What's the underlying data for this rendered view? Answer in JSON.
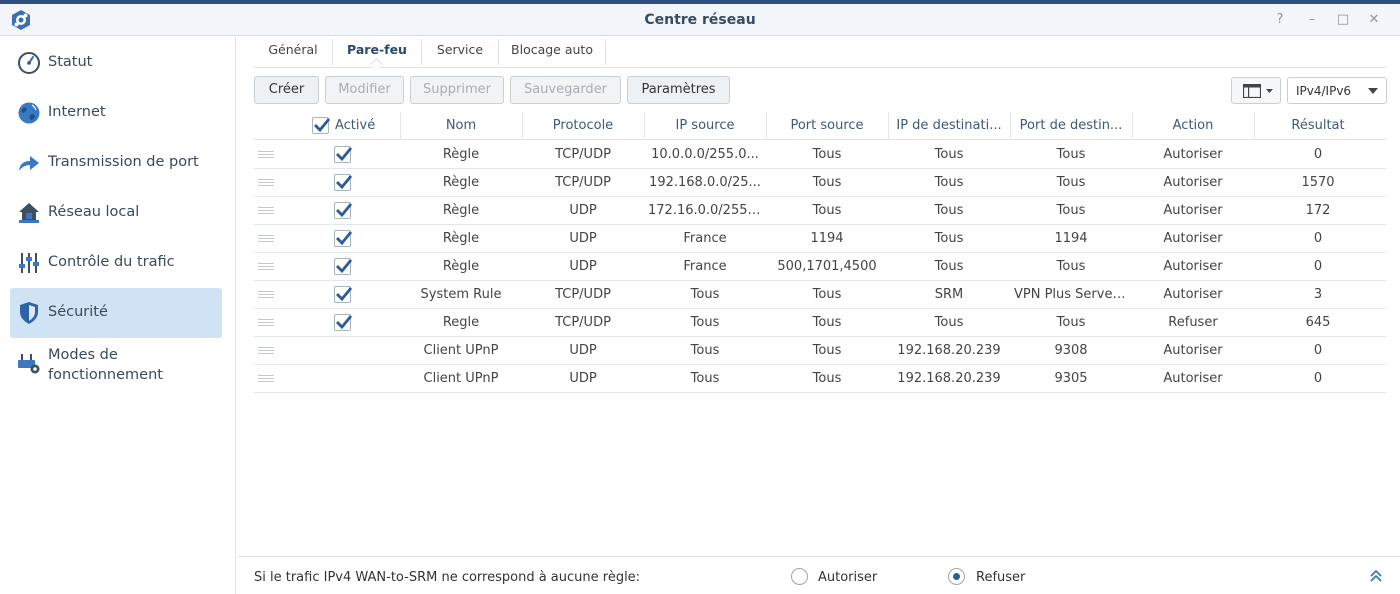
{
  "window": {
    "title": "Centre réseau",
    "controls": [
      "?",
      "–",
      "□",
      "✕"
    ]
  },
  "colors": {
    "accent": "#2a5c99",
    "active_nav": "#cfe3f4",
    "icon_blue": "#3a78c2"
  },
  "sidebar": {
    "items": [
      {
        "label": "Statut",
        "icon": "speedometer-icon"
      },
      {
        "label": "Internet",
        "icon": "globe-icon"
      },
      {
        "label": "Transmission de port",
        "icon": "forward-arrow-icon"
      },
      {
        "label": "Réseau local",
        "icon": "home-network-icon"
      },
      {
        "label": "Contrôle du trafic",
        "icon": "sliders-icon"
      },
      {
        "label": "Sécurité",
        "icon": "shield-icon",
        "active": true
      },
      {
        "label": "Modes de fonctionnement",
        "icon": "router-gear-icon"
      }
    ]
  },
  "tabs": [
    {
      "label": "Général"
    },
    {
      "label": "Pare-feu",
      "active": true
    },
    {
      "label": "Service"
    },
    {
      "label": "Blocage auto"
    }
  ],
  "toolbar": {
    "create": "Créer",
    "modify": "Modifier",
    "delete": "Supprimer",
    "save": "Sauvegarder",
    "settings": "Paramètres",
    "ip_version": "IPv4/IPv6"
  },
  "table": {
    "headers": {
      "enabled": "Activé",
      "name": "Nom",
      "protocol": "Protocole",
      "src_ip": "IP source",
      "src_port": "Port source",
      "dst_ip": "IP de destinati...",
      "dst_port": "Port de destin...",
      "action": "Action",
      "result": "Résultat"
    },
    "rows": [
      {
        "enabled": true,
        "name": "Règle",
        "protocol": "TCP/UDP",
        "src_ip": "10.0.0.0/255.0...",
        "src_port": "Tous",
        "dst_ip": "Tous",
        "dst_port": "Tous",
        "action": "Autoriser",
        "result": "0"
      },
      {
        "enabled": true,
        "name": "Règle",
        "protocol": "TCP/UDP",
        "src_ip": "192.168.0.0/25...",
        "src_port": "Tous",
        "dst_ip": "Tous",
        "dst_port": "Tous",
        "action": "Autoriser",
        "result": "1570"
      },
      {
        "enabled": true,
        "name": "Règle",
        "protocol": "UDP",
        "src_ip": "172.16.0.0/255....",
        "src_port": "Tous",
        "dst_ip": "Tous",
        "dst_port": "Tous",
        "action": "Autoriser",
        "result": "172"
      },
      {
        "enabled": true,
        "name": "Règle",
        "protocol": "UDP",
        "src_ip": "France",
        "src_port": "1194",
        "dst_ip": "Tous",
        "dst_port": "1194",
        "action": "Autoriser",
        "result": "0"
      },
      {
        "enabled": true,
        "name": "Règle",
        "protocol": "UDP",
        "src_ip": "France",
        "src_port": "500,1701,4500",
        "dst_ip": "Tous",
        "dst_port": "Tous",
        "action": "Autoriser",
        "result": "0"
      },
      {
        "enabled": true,
        "name": "System Rule",
        "protocol": "TCP/UDP",
        "src_ip": "Tous",
        "src_port": "Tous",
        "dst_ip": "SRM",
        "dst_port": "VPN Plus Server...",
        "action": "Autoriser",
        "result": "3"
      },
      {
        "enabled": true,
        "name": "Regle",
        "protocol": "TCP/UDP",
        "src_ip": "Tous",
        "src_port": "Tous",
        "dst_ip": "Tous",
        "dst_port": "Tous",
        "action": "Refuser",
        "result": "645"
      },
      {
        "enabled": false,
        "name": "Client UPnP",
        "protocol": "UDP",
        "src_ip": "Tous",
        "src_port": "Tous",
        "dst_ip": "192.168.20.239",
        "dst_port": "9308",
        "action": "Autoriser",
        "result": "0"
      },
      {
        "enabled": false,
        "name": "Client UPnP",
        "protocol": "UDP",
        "src_ip": "Tous",
        "src_port": "Tous",
        "dst_ip": "192.168.20.239",
        "dst_port": "9305",
        "action": "Autoriser",
        "result": "0"
      }
    ]
  },
  "footer": {
    "text": "Si le trafic IPv4 WAN-to-SRM ne correspond à aucune règle:",
    "option_allow": "Autoriser",
    "option_deny": "Refuser",
    "selected": "deny"
  }
}
